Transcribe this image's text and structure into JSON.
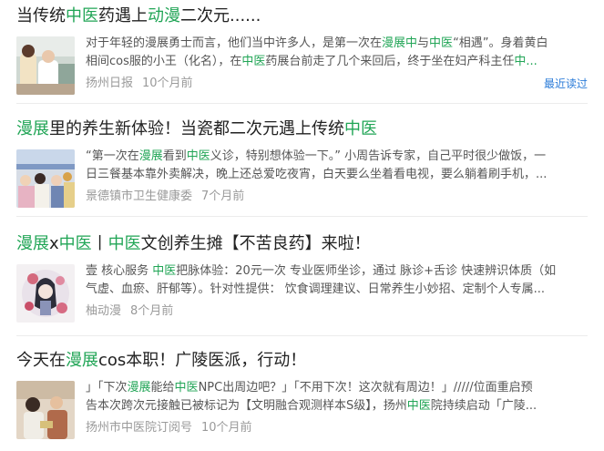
{
  "results": [
    {
      "title_parts": [
        {
          "t": "当传统",
          "h": false
        },
        {
          "t": "中医",
          "h": true
        },
        {
          "t": "药遇上",
          "h": false
        },
        {
          "t": "动漫",
          "h": true
        },
        {
          "t": "二次元......",
          "h": false
        }
      ],
      "snippet_lines": [
        [
          {
            "t": "对于年轻的漫展勇士而言，他们当中许多人，是第一次在",
            "h": false
          },
          {
            "t": "漫展中",
            "h": true
          },
          {
            "t": "与",
            "h": false
          },
          {
            "t": "中医",
            "h": true
          },
          {
            "t": "“相遇”。身着黄白",
            "h": false
          }
        ],
        [
          {
            "t": "相间cos服的小王（化名），在",
            "h": false
          },
          {
            "t": "中医",
            "h": true
          },
          {
            "t": "药展台前走了几个来回后，终于坐在妇产科主任",
            "h": false
          },
          {
            "t": "中...",
            "h": true
          }
        ]
      ],
      "source": "扬州日报",
      "time": "10个月前",
      "recent_label": "最近读过"
    },
    {
      "title_parts": [
        {
          "t": "漫展",
          "h": true
        },
        {
          "t": "里的养生新体验！当瓷都二次元遇上传统",
          "h": false
        },
        {
          "t": "中医",
          "h": true
        }
      ],
      "snippet_lines": [
        [
          {
            "t": "“第一次在",
            "h": false
          },
          {
            "t": "漫展",
            "h": true
          },
          {
            "t": "看到",
            "h": false
          },
          {
            "t": "中医",
            "h": true
          },
          {
            "t": "义诊，特别想体验一下。” 小周告诉专家，自己平时很少做饭，一",
            "h": false
          }
        ],
        [
          {
            "t": "日三餐基本靠外卖解决，晚上还总爱吃夜宵，白天要么坐着看电视，要么躺着刷手机，...",
            "h": false
          }
        ]
      ],
      "source": "景德镇市卫生健康委",
      "time": "7个月前"
    },
    {
      "title_parts": [
        {
          "t": "漫展",
          "h": true
        },
        {
          "t": "x",
          "h": false
        },
        {
          "t": "中医",
          "h": true
        },
        {
          "t": "丨",
          "h": false
        },
        {
          "t": "中医",
          "h": true
        },
        {
          "t": "文创养生摊【不苦良药】来啦！",
          "h": false
        }
      ],
      "snippet_lines": [
        [
          {
            "t": "壹 核心服务 ",
            "h": false
          },
          {
            "t": "中医",
            "h": true
          },
          {
            "t": "把脉体验：20元一次 专业医师坐诊，通过 脉诊+舌诊 快速辨识体质（如",
            "h": false
          }
        ],
        [
          {
            "t": "气虚、血瘀、肝郁等）。针对性提供： 饮食调理建议、日常养生小妙招、定制个人专属...",
            "h": false
          }
        ]
      ],
      "source": "柚动漫",
      "time": "8个月前"
    },
    {
      "title_parts": [
        {
          "t": "今天在",
          "h": false
        },
        {
          "t": "漫展",
          "h": true
        },
        {
          "t": "cos本职！广陵医派，行动！",
          "h": false
        }
      ],
      "snippet_lines": [
        [
          {
            "t": "」「下次",
            "h": false
          },
          {
            "t": "漫展",
            "h": true
          },
          {
            "t": "能给",
            "h": false
          },
          {
            "t": "中医",
            "h": true
          },
          {
            "t": "NPC出周边吧？」「不用下次！这次就有周边！」/////位面重启预",
            "h": false
          }
        ],
        [
          {
            "t": "告本次跨次元接触已被标记为【文明融合观测样本S级】，扬州",
            "h": false
          },
          {
            "t": "中医",
            "h": true
          },
          {
            "t": "院持续启动「广陵...",
            "h": false
          }
        ]
      ],
      "source": "扬州市中医院订阅号",
      "time": "10个月前"
    }
  ],
  "colors": {
    "highlight": "#21a556",
    "link": "#2a7bd8",
    "meta": "#9a9a9a"
  }
}
